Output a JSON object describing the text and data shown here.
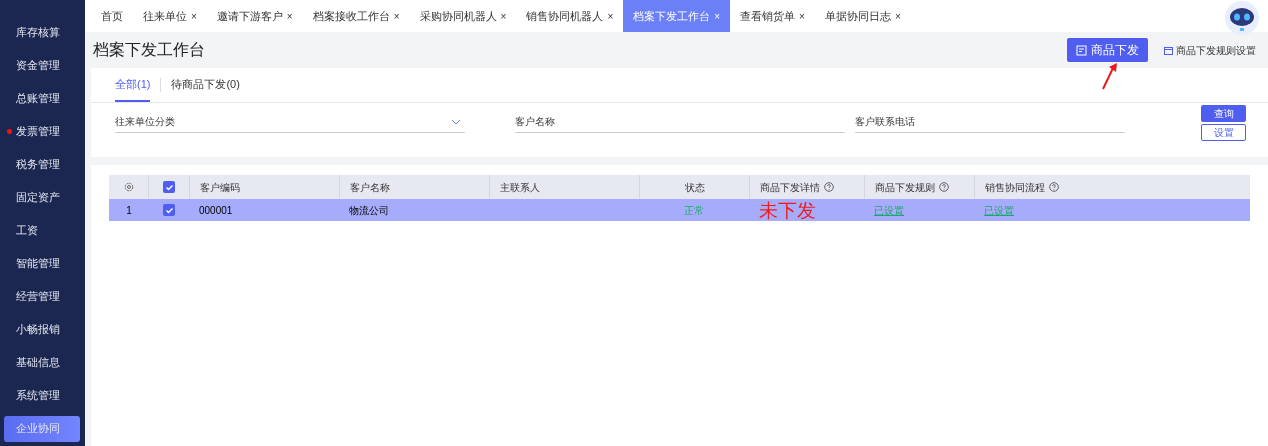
{
  "sidebar": {
    "items": [
      {
        "label": "库存核算",
        "selected": false,
        "badge": false
      },
      {
        "label": "资金管理",
        "selected": false,
        "badge": false
      },
      {
        "label": "总账管理",
        "selected": false,
        "badge": false
      },
      {
        "label": "发票管理",
        "selected": false,
        "badge": true
      },
      {
        "label": "税务管理",
        "selected": false,
        "badge": false
      },
      {
        "label": "固定资产",
        "selected": false,
        "badge": false
      },
      {
        "label": "工资",
        "selected": false,
        "badge": false
      },
      {
        "label": "智能管理",
        "selected": false,
        "badge": false
      },
      {
        "label": "经营管理",
        "selected": false,
        "badge": false
      },
      {
        "label": "小畅报销",
        "selected": false,
        "badge": false
      },
      {
        "label": "基础信息",
        "selected": false,
        "badge": false
      },
      {
        "label": "系统管理",
        "selected": false,
        "badge": false
      },
      {
        "label": "企业协同",
        "selected": true,
        "badge": false
      }
    ]
  },
  "tabs": [
    {
      "label": "首页",
      "selected": false
    },
    {
      "label": "往来单位",
      "selected": false,
      "close": "×"
    },
    {
      "label": "邀请下游客户",
      "selected": false,
      "close": "×"
    },
    {
      "label": "档案接收工作台",
      "selected": false,
      "close": "×"
    },
    {
      "label": "采购协同机器人",
      "selected": false,
      "close": "×"
    },
    {
      "label": "销售协同机器人",
      "selected": false,
      "close": "×"
    },
    {
      "label": "档案下发工作台",
      "selected": true,
      "close": "×"
    },
    {
      "label": "查看销货单",
      "selected": false,
      "close": "×"
    },
    {
      "label": "单据协同日志",
      "selected": false,
      "close": "×"
    }
  ],
  "page": {
    "title": "档案下发工作台",
    "primary_button": "商品下发",
    "rule_link": "商品下发规则设置"
  },
  "sub_tabs": [
    {
      "label": "全部(1)",
      "selected": true
    },
    {
      "label": "待商品下发(0)",
      "selected": false
    }
  ],
  "filters": [
    {
      "kind": "select",
      "label": "往来单位分类"
    },
    {
      "kind": "text",
      "label": "客户名称"
    },
    {
      "kind": "text",
      "label": "客户联系电话"
    }
  ],
  "filter_buttons": {
    "search": "查询",
    "settings": "设置"
  },
  "table": {
    "header_checked": true,
    "columns": [
      {
        "label": "客户编码",
        "help": false
      },
      {
        "label": "客户名称",
        "help": false
      },
      {
        "label": "主联系人",
        "help": false
      },
      {
        "label": "状态",
        "help": false
      },
      {
        "label": "商品下发详情",
        "help": true
      },
      {
        "label": "商品下发规则",
        "help": true
      },
      {
        "label": "销售协同流程",
        "help": true
      }
    ],
    "rows": [
      {
        "index": "1",
        "checked": true,
        "selected": true,
        "code": "000001",
        "name": "物流公司",
        "status": "正常",
        "detail": "未下发",
        "rule": "已设置",
        "flow": "已设置"
      }
    ]
  }
}
